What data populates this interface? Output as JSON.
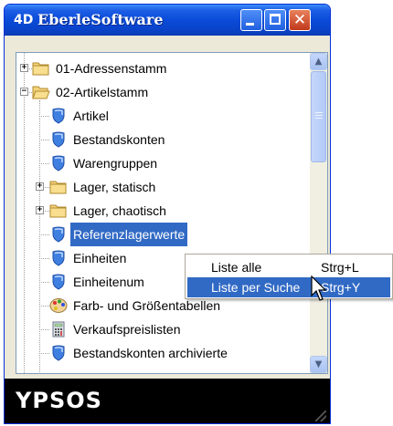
{
  "window": {
    "title": "EberleSoftware",
    "icon": "4D",
    "buttons": [
      "minimize",
      "maximize",
      "close"
    ],
    "close_glyph": "✕"
  },
  "tree": {
    "items": [
      {
        "label": "01-Adressenstamm",
        "icon": "folder-icon",
        "expander": "+"
      },
      {
        "label": "02-Artikelstamm",
        "icon": "folder-open-icon",
        "expander": "−"
      },
      {
        "label": "Artikel",
        "icon": "shield-icon"
      },
      {
        "label": "Bestandskonten",
        "icon": "shield-icon"
      },
      {
        "label": "Warengruppen",
        "icon": "shield-icon"
      },
      {
        "label": "Lager, statisch",
        "icon": "folder-icon",
        "expander": "+"
      },
      {
        "label": "Lager, chaotisch",
        "icon": "folder-icon",
        "expander": "+"
      },
      {
        "label": "Referenzlagerwerte",
        "icon": "shield-icon",
        "selected": true
      },
      {
        "label": "Einheiten",
        "icon": "shield-icon"
      },
      {
        "label": "Einheitenum",
        "icon": "shield-icon"
      },
      {
        "label": "Farb- und Größentabellen",
        "icon": "palette-icon"
      },
      {
        "label": "Verkaufspreislisten",
        "icon": "calculator-icon"
      },
      {
        "label": "Bestandskonten archivierte",
        "icon": "shield-icon"
      }
    ]
  },
  "scrollbar": {
    "up": "▲",
    "down": "▼"
  },
  "context_menu": {
    "items": [
      {
        "label": "Liste alle",
        "shortcut": "Strg+L"
      },
      {
        "label": "Liste per Suche",
        "shortcut": "Strg+Y",
        "hover": true
      }
    ]
  },
  "footer": {
    "logo": "YPSOS"
  },
  "colors": {
    "title_bar": "#0A4BD8",
    "selection": "#316AC5",
    "window_bg": "#ECE9D8",
    "footer_bg": "#000000",
    "close_button": "#C0391B"
  }
}
